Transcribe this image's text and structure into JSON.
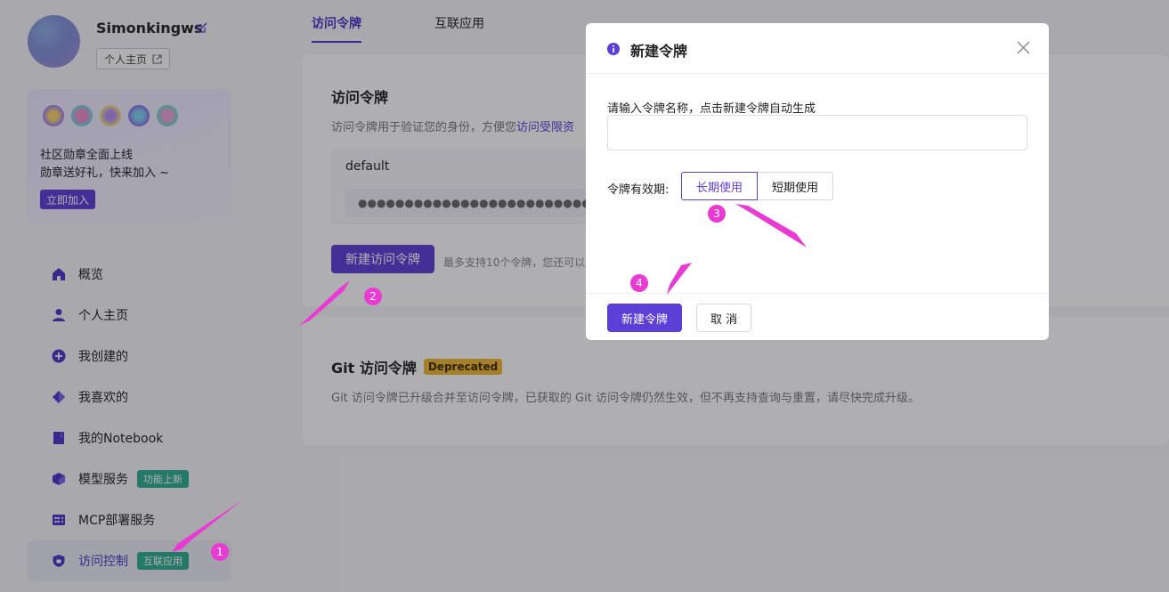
{
  "user": {
    "name": "Simonkingws",
    "profile_button": "个人主页"
  },
  "badge_card": {
    "line1": "社区勋章全面上线",
    "line2": "勋章送好礼，快来加入 ~",
    "join_button": "立即加入"
  },
  "nav": {
    "items": [
      {
        "label": "概览",
        "icon": "home-icon"
      },
      {
        "label": "个人主页",
        "icon": "user-icon"
      },
      {
        "label": "我创建的",
        "icon": "plus-circle-icon"
      },
      {
        "label": "我喜欢的",
        "icon": "diamond-icon"
      },
      {
        "label": "我的Notebook",
        "icon": "notebook-icon"
      },
      {
        "label": "模型服务",
        "icon": "cube-icon",
        "tag": "功能上新"
      },
      {
        "label": "MCP部署服务",
        "icon": "server-icon"
      },
      {
        "label": "访问控制",
        "icon": "shield-icon",
        "tag": "互联应用",
        "active": true
      }
    ]
  },
  "tabs": [
    {
      "label": "访问令牌",
      "active": true
    },
    {
      "label": "互联应用"
    }
  ],
  "access_token": {
    "title": "访问令牌",
    "desc_prefix": "访问令牌用于验证您的身份，方便您",
    "desc_link": "访问受限资",
    "token_name": "default",
    "token_mask": "●●●●●●●●●●●●●●●●●●●●●●●●●●●●●●●●●●●●",
    "new_button": "新建访问令牌",
    "limit_text": "最多支持10个令牌，您还可以"
  },
  "git_token": {
    "title": "Git 访问令牌",
    "badge": "Deprecated",
    "desc": "Git 访问令牌已升级合并至访问令牌，已获取的 Git 访问令牌仍然生效，但不再支持查询与重置，请尽快完成升级。"
  },
  "modal": {
    "title": "新建令牌",
    "field_label": "请输入令牌名称，点击新建令牌自动生成",
    "input_value": "",
    "validity_label": "令牌有效期:",
    "options": [
      "长期使用",
      "短期使用"
    ],
    "confirm": "新建令牌",
    "cancel": "取 消"
  },
  "annotations": [
    "1",
    "2",
    "3",
    "4"
  ],
  "colors": {
    "accent": "#5b3fd6",
    "annotation": "#e93ad3",
    "tag_green": "#2fae8f",
    "deprecated": "#f0b82e"
  }
}
